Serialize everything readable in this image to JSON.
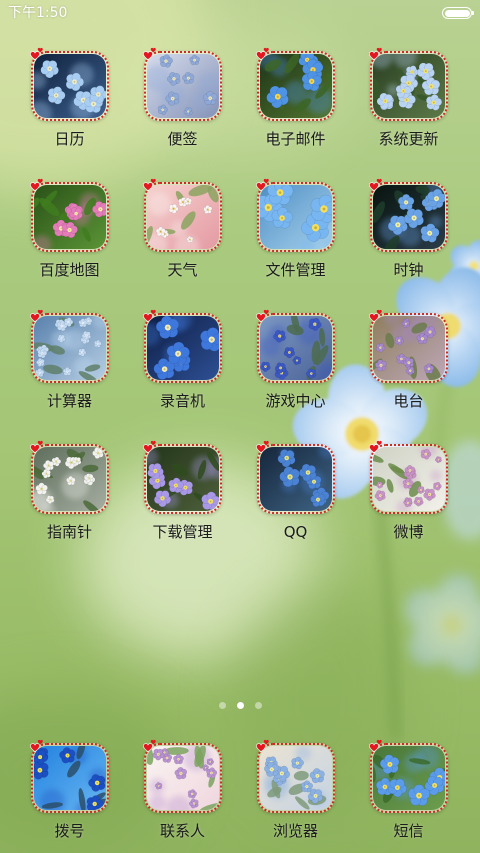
{
  "status_bar": {
    "time": "下午1:50",
    "battery_icon": "battery-icon",
    "battery_level": 1.0
  },
  "apps": [
    {
      "label": "日历",
      "icon": "calendar-app-icon",
      "colors": {
        "bg": [
          "#10223d",
          "#3c5f8e"
        ],
        "flower": "#a8cdf2",
        "center": "#f2eec0",
        "leaf": null
      }
    },
    {
      "label": "便签",
      "icon": "notes-app-icon",
      "colors": {
        "bg": [
          "#d6dcec",
          "#8593b8"
        ],
        "flower": "#8ea8d8",
        "center": "#f0e9b8",
        "leaf": null
      }
    },
    {
      "label": "电子邮件",
      "icon": "email-app-icon",
      "colors": {
        "bg": [
          "#1e3418",
          "#53772f"
        ],
        "flower": "#4f93e4",
        "center": "#f6d64c",
        "leaf": "#3c6526"
      }
    },
    {
      "label": "系统更新",
      "icon": "system-update-app-icon",
      "colors": {
        "bg": [
          "#2a3f22",
          "#5c7a48"
        ],
        "flower": "#b9d3f3",
        "center": "#f3e36a",
        "leaf": "#36572a"
      }
    },
    {
      "label": "百度地图",
      "icon": "baidu-maps-app-icon",
      "colors": {
        "bg": [
          "#2a5218",
          "#5b9436"
        ],
        "flower": "#e47cba",
        "center": "#fff1a6",
        "leaf": "#3f7d1f"
      }
    },
    {
      "label": "天气",
      "icon": "weather-app-icon",
      "colors": {
        "bg": [
          "#f6d2cf",
          "#e49aa3"
        ],
        "flower": "#fbf4f2",
        "center": "#e9c562",
        "leaf": "#8ba35f"
      }
    },
    {
      "label": "文件管理",
      "icon": "file-manager-app-icon",
      "colors": {
        "bg": [
          "#4f8fc4",
          "#a7d1ec"
        ],
        "flower": "#78b6f2",
        "center": "#f6df58",
        "leaf": null
      }
    },
    {
      "label": "时钟",
      "icon": "clock-app-icon",
      "colors": {
        "bg": [
          "#08140f",
          "#2a3c48"
        ],
        "flower": "#6aa2e6",
        "center": "#f2f0a4",
        "leaf": "#1f3d2a"
      }
    },
    {
      "label": "计算器",
      "icon": "calculator-app-icon",
      "colors": {
        "bg": [
          "#5a82ad",
          "#b5cde3"
        ],
        "flower": "#c3dcf4",
        "center": "#f3f3ff",
        "leaf": "#5f7f6a"
      }
    },
    {
      "label": "录音机",
      "icon": "recorder-app-icon",
      "colors": {
        "bg": [
          "#0f1f46",
          "#2d4f93"
        ],
        "flower": "#3f78dc",
        "center": "#f3ebb4",
        "leaf": null
      }
    },
    {
      "label": "游戏中心",
      "icon": "game-center-app-icon",
      "colors": {
        "bg": [
          "#7d98c3",
          "#4b6398"
        ],
        "flower": "#3b58c2",
        "center": "#e2d27e",
        "leaf": "#4c6b4f"
      }
    },
    {
      "label": "电台",
      "icon": "radio-app-icon",
      "colors": {
        "bg": [
          "#8f7f5d",
          "#bda7b8"
        ],
        "flower": "#a587cc",
        "center": "#f0e2a2",
        "leaf": "#6b7b4b"
      }
    },
    {
      "label": "指南针",
      "icon": "compass-app-icon",
      "colors": {
        "bg": [
          "#5f6f5c",
          "#a5ada1"
        ],
        "flower": "#f2f2ee",
        "center": "#e0df9e",
        "leaf": "#4b6a3a"
      }
    },
    {
      "label": "下载管理",
      "icon": "download-manager-app-icon",
      "colors": {
        "bg": [
          "#24361a",
          "#4d5f3a"
        ],
        "flower": "#a898e6",
        "center": "#f2e062",
        "leaf": "#2f4b1f"
      }
    },
    {
      "label": "QQ",
      "icon": "qq-app-icon",
      "colors": {
        "bg": [
          "#15263a",
          "#3f6486"
        ],
        "flower": "#4a82d4",
        "center": "#e6e482",
        "leaf": null
      }
    },
    {
      "label": "微博",
      "icon": "weibo-app-icon",
      "colors": {
        "bg": [
          "#cfd2c5",
          "#f2f1ea"
        ],
        "flower": "#c893c6",
        "center": "#f2e2a0",
        "leaf": "#6c8c4b"
      }
    }
  ],
  "pager": {
    "pages": 3,
    "active_index": 1
  },
  "dock": [
    {
      "label": "拨号",
      "icon": "dialer-app-icon",
      "colors": {
        "bg": [
          "#2382df",
          "#67b6f2"
        ],
        "flower": "#1b4fc2",
        "center": "#f2e45e",
        "leaf": "#2a4f6a"
      }
    },
    {
      "label": "联系人",
      "icon": "contacts-app-icon",
      "colors": {
        "bg": [
          "#faf4f2",
          "#efd6de"
        ],
        "flower": "#b993d2",
        "center": "#f2e3a2",
        "leaf": "#7ba35e"
      }
    },
    {
      "label": "浏览器",
      "icon": "browser-app-icon",
      "colors": {
        "bg": [
          "#ebe3d2",
          "#c4d3e4"
        ],
        "flower": "#8bb1e2",
        "center": "#f3efa6",
        "leaf": "#7f9a7a"
      }
    },
    {
      "label": "短信",
      "icon": "messages-app-icon",
      "colors": {
        "bg": [
          "#48773a",
          "#6d9d4d"
        ],
        "flower": "#5b9cea",
        "center": "#f3e060",
        "leaf": "#3b6b2a"
      }
    }
  ],
  "theme": {
    "frame_color": "#cf2a20",
    "heart_color": "#e3171f",
    "label_color": "#1c1c1c",
    "status_text_color": "#ffffff"
  }
}
